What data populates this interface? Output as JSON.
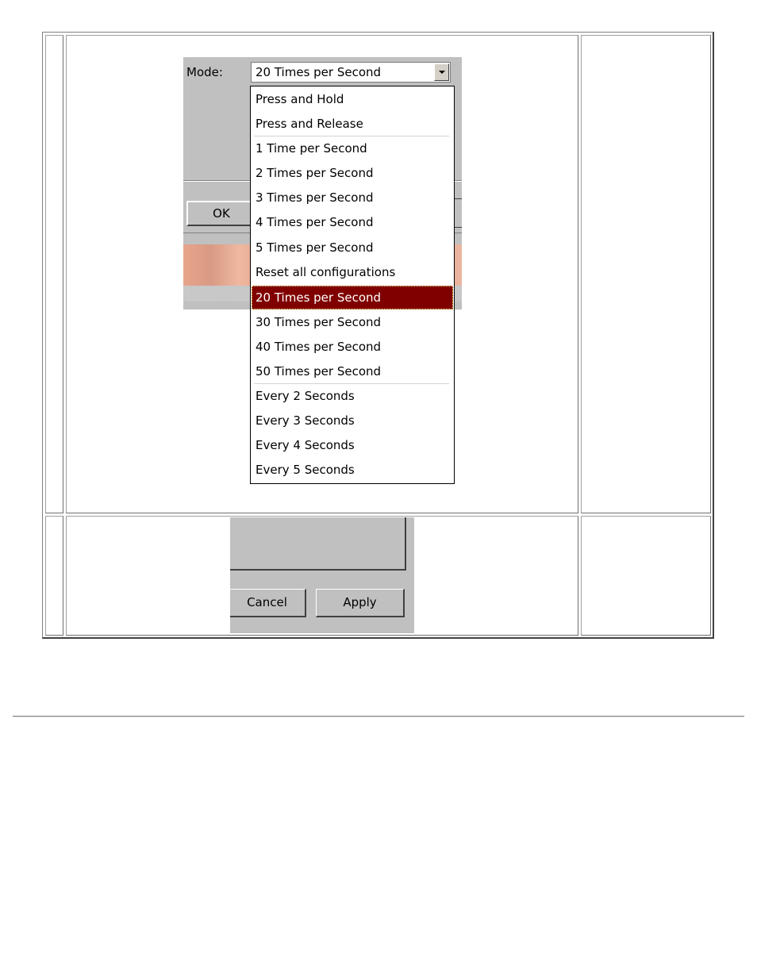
{
  "top_panel": {
    "mode_label": "Mode:",
    "selected_value": "20 Times per Second",
    "ok_label": "OK"
  },
  "dropdown": {
    "options": [
      "Press and Hold",
      "Press and Release",
      "1 Time per Second",
      "2 Times per Second",
      "3 Times per Second",
      "4 Times per Second",
      "5 Times per Second",
      "Reset all configurations",
      "20 Times per Second",
      "30 Times per Second",
      "40 Times per Second",
      "50 Times per Second",
      "Every 2 Seconds",
      "Every 3 Seconds",
      "Every 4 Seconds",
      "Every 5 Seconds"
    ],
    "highlighted": "20 Times per Second",
    "highlight_color": "#800000"
  },
  "bottom_panel": {
    "cancel_label": "Cancel",
    "apply_label": "Apply"
  }
}
